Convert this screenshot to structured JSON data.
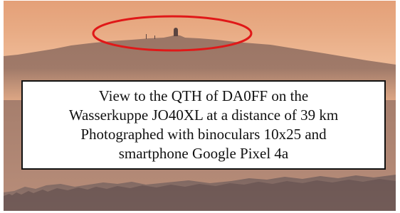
{
  "caption": {
    "lines": [
      "View to the QTH of DA0FF on the",
      "Wasserkuppe JO40XL at a distance of 39 km",
      "Photographed with binoculars 10x25 and",
      "smartphone Google Pixel 4a"
    ]
  },
  "photo": {
    "subject": "hazy ridge silhouette at sunset with marked summit",
    "marker": "red-ellipse",
    "colors": {
      "sky": "#e9b592",
      "ridge": "#8c6a5e",
      "foreground_hills": "#6e5b58",
      "marker": "#e01818"
    }
  }
}
